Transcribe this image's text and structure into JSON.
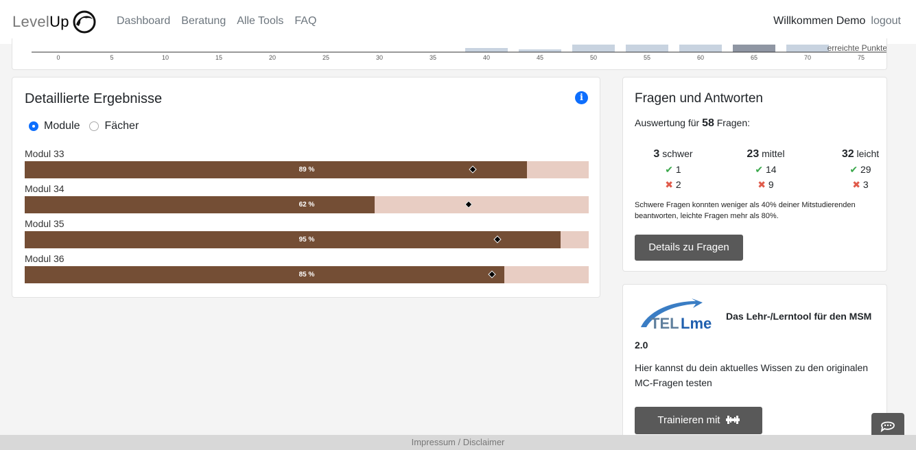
{
  "nav": {
    "brand_part1": "Level",
    "brand_part2": "Up",
    "links": [
      "Dashboard",
      "Beratung",
      "Alle Tools",
      "FAQ"
    ],
    "welcome": "Willkommen Demo",
    "logout": "logout"
  },
  "points_chart": {
    "axis_label": "erreichte Punkte",
    "ticks": [
      "0",
      "5",
      "10",
      "15",
      "20",
      "25",
      "30",
      "35",
      "40",
      "45",
      "50",
      "55",
      "60",
      "65",
      "70",
      "75"
    ]
  },
  "results": {
    "title": "Detaillierte Ergebnisse",
    "radio_modules": "Module",
    "radio_subjects": "Fächer",
    "modules": [
      {
        "label": "Modul 33",
        "pct_text": "89 %",
        "value": 0.89,
        "marker": 0.795
      },
      {
        "label": "Modul 34",
        "pct_text": "62 %",
        "value": 0.62,
        "marker": 0.787
      },
      {
        "label": "Modul 35",
        "pct_text": "95 %",
        "value": 0.95,
        "marker": 0.838
      },
      {
        "label": "Modul 36",
        "pct_text": "85 %",
        "value": 0.85,
        "marker": 0.828
      }
    ]
  },
  "qa": {
    "title": "Fragen und Antworten",
    "sub_prefix": "Auswertung für",
    "total": "58",
    "sub_suffix": "Fragen:",
    "cols": [
      {
        "count": "3",
        "label": "schwer",
        "ok": "1",
        "bad": "2"
      },
      {
        "count": "23",
        "label": "mittel",
        "ok": "14",
        "bad": "9"
      },
      {
        "count": "32",
        "label": "leicht",
        "ok": "29",
        "bad": "3"
      }
    ],
    "note": "Schwere Fragen konnten weniger als 40% deiner Mitstudierenden beantworten, leichte Fragen mehr als 80%.",
    "button": "Details zu Fragen"
  },
  "tell": {
    "logo_text_a": "TEL",
    "logo_text_b": "Lme",
    "heading": "Das Lehr-/Lerntool für den MSM",
    "version": "2.0",
    "desc": "Hier kannst du dein aktuelles Wissen zu den originalen MC-Fragen testen",
    "button": "Trainieren mit"
  },
  "footer": {
    "text": "Impressum / Disclaimer"
  },
  "colors": {
    "bar_fill": "#744e35",
    "bar_track": "#e8cdc3",
    "accent": "#0d6efd"
  }
}
